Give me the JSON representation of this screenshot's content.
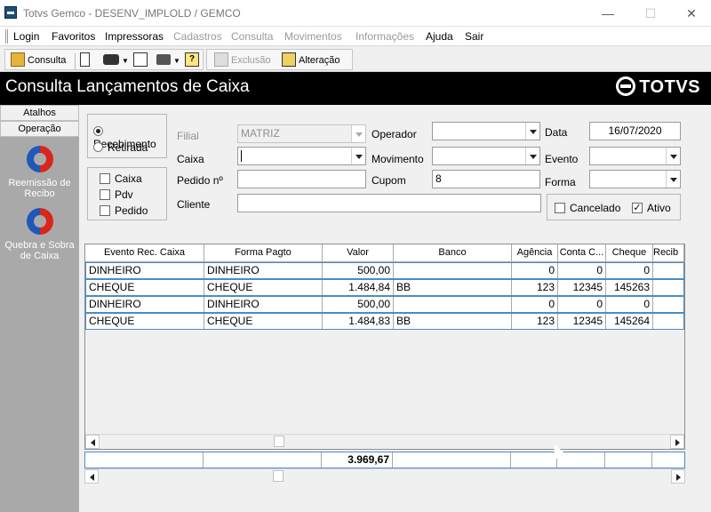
{
  "window": {
    "title": "Totvs Gemco - DESENV_IMPLOLD / GEMCO",
    "minimize": "—",
    "maximize": "☐",
    "close": "✕"
  },
  "menu": {
    "items": [
      {
        "label": "Login",
        "enabled": true
      },
      {
        "label": "Favoritos",
        "enabled": true
      },
      {
        "label": "Impressoras",
        "enabled": true
      },
      {
        "label": "Cadastros",
        "enabled": false
      },
      {
        "label": "Consulta",
        "enabled": false
      },
      {
        "label": "Movimentos",
        "enabled": false
      },
      {
        "label": "Informações",
        "enabled": false
      },
      {
        "label": "Ajuda",
        "enabled": true
      },
      {
        "label": "Sair",
        "enabled": true
      }
    ]
  },
  "toolbar": {
    "consulta": "Consulta",
    "exclusao": "Exclusão",
    "alteracao": "Alteração"
  },
  "header": {
    "title": "Consulta Lançamentos de Caixa",
    "logo": "TOTVS"
  },
  "sidebar": {
    "tabs": [
      "Atalhos",
      "Operação"
    ],
    "actions": [
      {
        "label": "Reemissão de Recibo"
      },
      {
        "label": "Quebra e Sobra de Caixa"
      }
    ]
  },
  "filters": {
    "tipo": {
      "options": [
        "Recebimento",
        "Retirada"
      ],
      "selected": "Recebimento"
    },
    "origem": {
      "caixa": {
        "label": "Caixa",
        "checked": false
      },
      "pdv": {
        "label": "Pdv",
        "checked": false
      },
      "pedido": {
        "label": "Pedido",
        "checked": false
      }
    },
    "labels": {
      "filial": "Filial",
      "caixa": "Caixa",
      "pedido_n": "Pedido nº",
      "cliente": "Cliente",
      "operador": "Operador",
      "movimento": "Movimento",
      "cupom": "Cupom",
      "data": "Data",
      "evento": "Evento",
      "forma": "Forma"
    },
    "values": {
      "filial": "MATRIZ",
      "caixa": "",
      "pedido_n": "",
      "cliente": "",
      "operador": "",
      "movimento": "",
      "cupom": "8",
      "data": "16/07/2020",
      "evento": "",
      "forma": ""
    },
    "status": {
      "cancelado": {
        "label": "Cancelado",
        "checked": false
      },
      "ativo": {
        "label": "Ativo",
        "checked": true
      }
    }
  },
  "grid": {
    "columns": [
      "Evento Rec. Caixa",
      "Forma Pagto",
      "Valor",
      "Banco",
      "Agência",
      "Conta C...",
      "Cheque",
      "Recib"
    ],
    "rows": [
      [
        "DINHEIRO",
        "DINHEIRO",
        "500,00",
        "",
        "0",
        "0",
        "0",
        ""
      ],
      [
        "CHEQUE",
        "CHEQUE",
        "1.484,84",
        "BB",
        "123",
        "12345",
        "145263",
        ""
      ],
      [
        "DINHEIRO",
        "DINHEIRO",
        "500,00",
        "",
        "0",
        "0",
        "0",
        ""
      ],
      [
        "CHEQUE",
        "CHEQUE",
        "1.484,83",
        "BB",
        "123",
        "12345",
        "145264",
        ""
      ]
    ]
  },
  "totals": {
    "valor": "3.969,67"
  },
  "colors": {
    "header_bg": "#000000",
    "sidebar_bg": "#a9a9a9",
    "row_border": "#4a8cc9",
    "icon_red": "#d9261c",
    "icon_blue": "#1f58b8"
  }
}
